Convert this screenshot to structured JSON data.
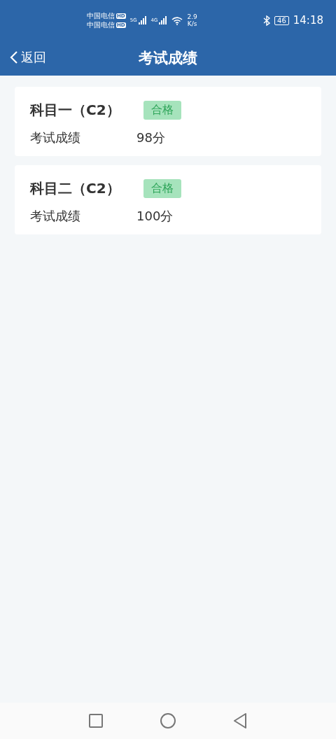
{
  "status_bar": {
    "carriers": [
      {
        "name": "中国电信",
        "badge": "HD"
      },
      {
        "name": "中国电信",
        "badge": "HD"
      }
    ],
    "networks": [
      "5G",
      "4G"
    ],
    "speed": [
      "2.9",
      "K/s"
    ],
    "battery": "46",
    "time": "14:18"
  },
  "header": {
    "back": "返回",
    "title": "考试成绩"
  },
  "results": [
    {
      "subject": "科目一（C2）",
      "status": "合格",
      "label": "考试成绩",
      "score": "98分"
    },
    {
      "subject": "科目二（C2）",
      "status": "合格",
      "label": "考试成绩",
      "score": "100分"
    }
  ]
}
